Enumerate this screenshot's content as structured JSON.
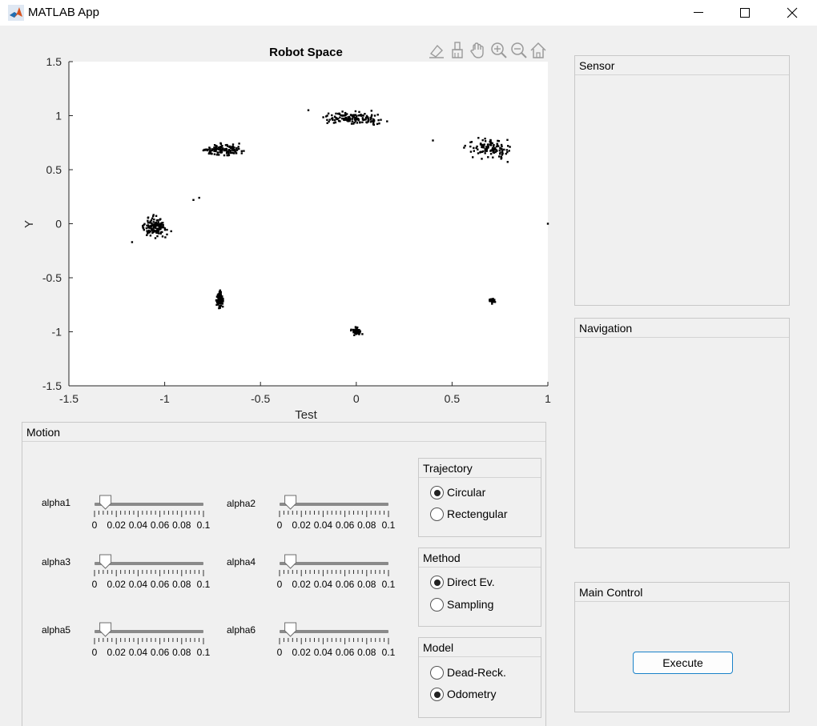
{
  "window": {
    "title": "MATLAB App"
  },
  "axes": {
    "title": "Robot Space",
    "xlabel": "Test",
    "ylabel": "Y",
    "xlim": [
      -1.5,
      1
    ],
    "ylim": [
      -1.5,
      1.5
    ],
    "xticks": [
      "-1.5",
      "-1",
      "-0.5",
      "0",
      "0.5",
      "1"
    ],
    "yticks": [
      "1.5",
      "1",
      "0.5",
      "0",
      "-0.5",
      "-1",
      "-1.5"
    ],
    "toolbar_icons": [
      "data-tips-icon",
      "brush-icon",
      "pan-icon",
      "zoom-in-icon",
      "zoom-out-icon",
      "home-icon"
    ]
  },
  "chart_data": {
    "type": "scatter",
    "title": "Robot Space",
    "xlabel": "Test",
    "ylabel": "Y",
    "xlim": [
      -1.5,
      1
    ],
    "ylim": [
      -1.5,
      1.5
    ],
    "marker_color": "#000000",
    "clusters": [
      {
        "center": [
          -1.05,
          -0.03
        ],
        "spread": [
          0.06,
          0.08
        ],
        "count": 130
      },
      {
        "center": [
          -0.7,
          0.68
        ],
        "spread": [
          0.11,
          0.05
        ],
        "count": 120
      },
      {
        "center": [
          -0.02,
          0.98
        ],
        "spread": [
          0.14,
          0.05
        ],
        "count": 150
      },
      {
        "center": [
          0.7,
          0.7
        ],
        "spread": [
          0.12,
          0.08
        ],
        "count": 110
      },
      {
        "center": [
          -0.71,
          -0.7
        ],
        "spread": [
          0.015,
          0.07
        ],
        "count": 100
      },
      {
        "center": [
          0.0,
          -1.0
        ],
        "spread": [
          0.02,
          0.03
        ],
        "count": 80
      },
      {
        "center": [
          0.71,
          -0.71
        ],
        "spread": [
          0.012,
          0.02
        ],
        "count": 40
      }
    ],
    "extra_points": [
      [
        -0.85,
        0.22
      ],
      [
        -0.82,
        0.24
      ],
      [
        -1.17,
        -0.17
      ],
      [
        1.0,
        0.0
      ],
      [
        0.4,
        0.77
      ],
      [
        -0.25,
        1.05
      ]
    ]
  },
  "motion": {
    "title": "Motion",
    "slider_ticks": [
      "0",
      "0.02",
      "0.04",
      "0.06",
      "0.08",
      "0.1"
    ],
    "sliders": [
      {
        "label": "alpha1",
        "value": 0.01
      },
      {
        "label": "alpha2",
        "value": 0.01
      },
      {
        "label": "alpha3",
        "value": 0.01
      },
      {
        "label": "alpha4",
        "value": 0.01
      },
      {
        "label": "alpha5",
        "value": 0.01
      },
      {
        "label": "alpha6",
        "value": 0.01
      }
    ]
  },
  "trajectory": {
    "title": "Trajectory",
    "options": [
      "Circular",
      "Rectengular"
    ],
    "selected": "Circular"
  },
  "method": {
    "title": "Method",
    "options": [
      "Direct Ev.",
      "Sampling"
    ],
    "selected": "Direct Ev."
  },
  "model": {
    "title": "Model",
    "options": [
      "Dead-Reck.",
      "Odometry"
    ],
    "selected": "Odometry"
  },
  "sensor": {
    "title": "Sensor"
  },
  "navigation": {
    "title": "Navigation"
  },
  "main_control": {
    "title": "Main Control",
    "execute_label": "Execute",
    "button_border": "#1a82c9"
  }
}
